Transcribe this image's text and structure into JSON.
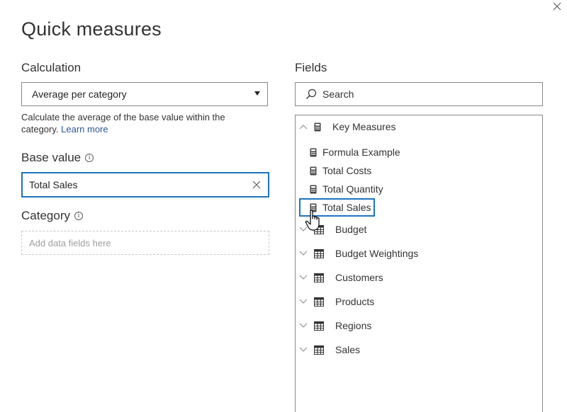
{
  "dialog": {
    "title": "Quick measures"
  },
  "calculation": {
    "label": "Calculation",
    "selected": "Average per category",
    "description": "Calculate the average of the base value within the category.",
    "learn_more": "Learn more"
  },
  "base_value": {
    "label": "Base value",
    "value": "Total Sales"
  },
  "category": {
    "label": "Category",
    "placeholder": "Add data fields here"
  },
  "fields": {
    "label": "Fields",
    "search_placeholder": "Search",
    "tree": [
      {
        "name": "Key Measures",
        "type": "measure-table",
        "expanded": true,
        "children": [
          "Formula Example",
          "Total Costs",
          "Total Quantity",
          "Total Sales"
        ]
      },
      {
        "name": "Budget",
        "type": "table",
        "expanded": false
      },
      {
        "name": "Budget Weightings",
        "type": "table",
        "expanded": false
      },
      {
        "name": "Customers",
        "type": "table",
        "expanded": false
      },
      {
        "name": "Products",
        "type": "table",
        "expanded": false
      },
      {
        "name": "Regions",
        "type": "table",
        "expanded": false
      },
      {
        "name": "Sales",
        "type": "table",
        "expanded": false
      }
    ],
    "selected_field": "Total Sales"
  },
  "colors": {
    "accent": "#1e73be",
    "link": "#2b579a",
    "border": "#8a8886"
  },
  "icons": {
    "close": "close-icon",
    "dropdown": "chevron-down-icon",
    "info": "info-icon",
    "search": "search-icon",
    "measure": "calculator-icon",
    "table": "table-icon",
    "expand": "chevron-icon"
  }
}
